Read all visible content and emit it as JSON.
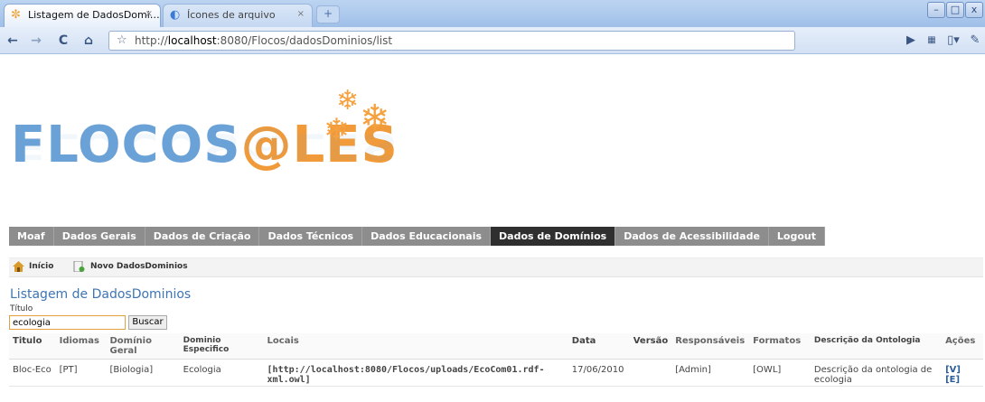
{
  "browser": {
    "tabs": [
      {
        "title": "Listagem de DadosDomi…",
        "close": "×"
      },
      {
        "title": "Ícones de arquivo",
        "close": "×"
      }
    ],
    "new_tab": "+",
    "window_controls": [
      "–",
      "□",
      "x"
    ],
    "url": {
      "prefix": "http://",
      "host": "localhost",
      "rest": ":8080/Flocos/dadosDominios/list"
    }
  },
  "logo": {
    "part1": "FLOCOS",
    "at": "@",
    "part2": "LES"
  },
  "nav": {
    "items": [
      "Moaf",
      "Dados Gerais",
      "Dados de Criação",
      "Dados Técnicos",
      "Dados Educacionais",
      "Dados de Domínios",
      "Dados de Acessibilidade",
      "Logout"
    ],
    "active_index": 5
  },
  "actions": {
    "home": "Início",
    "new": "Novo DadosDominios"
  },
  "page": {
    "title": "Listagem de DadosDominios"
  },
  "filter": {
    "label": "Título",
    "value": "ecologia",
    "button": "Buscar"
  },
  "table": {
    "headers": {
      "titulo": "Titulo",
      "idiomas": "Idiomas",
      "dominio_geral": "Domínio Geral",
      "dominio_especifico": "Dominio Especifico",
      "locais": "Locais",
      "data": "Data",
      "versao": "Versão",
      "responsaveis": "Responsáveis",
      "formatos": "Formatos",
      "descricao": "Descrição da Ontologia",
      "acoes": "Ações"
    },
    "rows": [
      {
        "titulo": "Bloc-Eco",
        "idiomas": "[PT]",
        "dominio_geral": "[Biologia]",
        "dominio_especifico": "Ecologia",
        "locais": "[http://localhost:8080/Flocos/uploads/EcoCom01.rdf-xml.owl]",
        "data": "17/06/2010",
        "versao": "",
        "responsaveis": "[Admin]",
        "formatos": "[OWL]",
        "descricao": "Descrição da ontologia de ecologia",
        "view": "[V]",
        "edit": "[E]"
      }
    ]
  }
}
